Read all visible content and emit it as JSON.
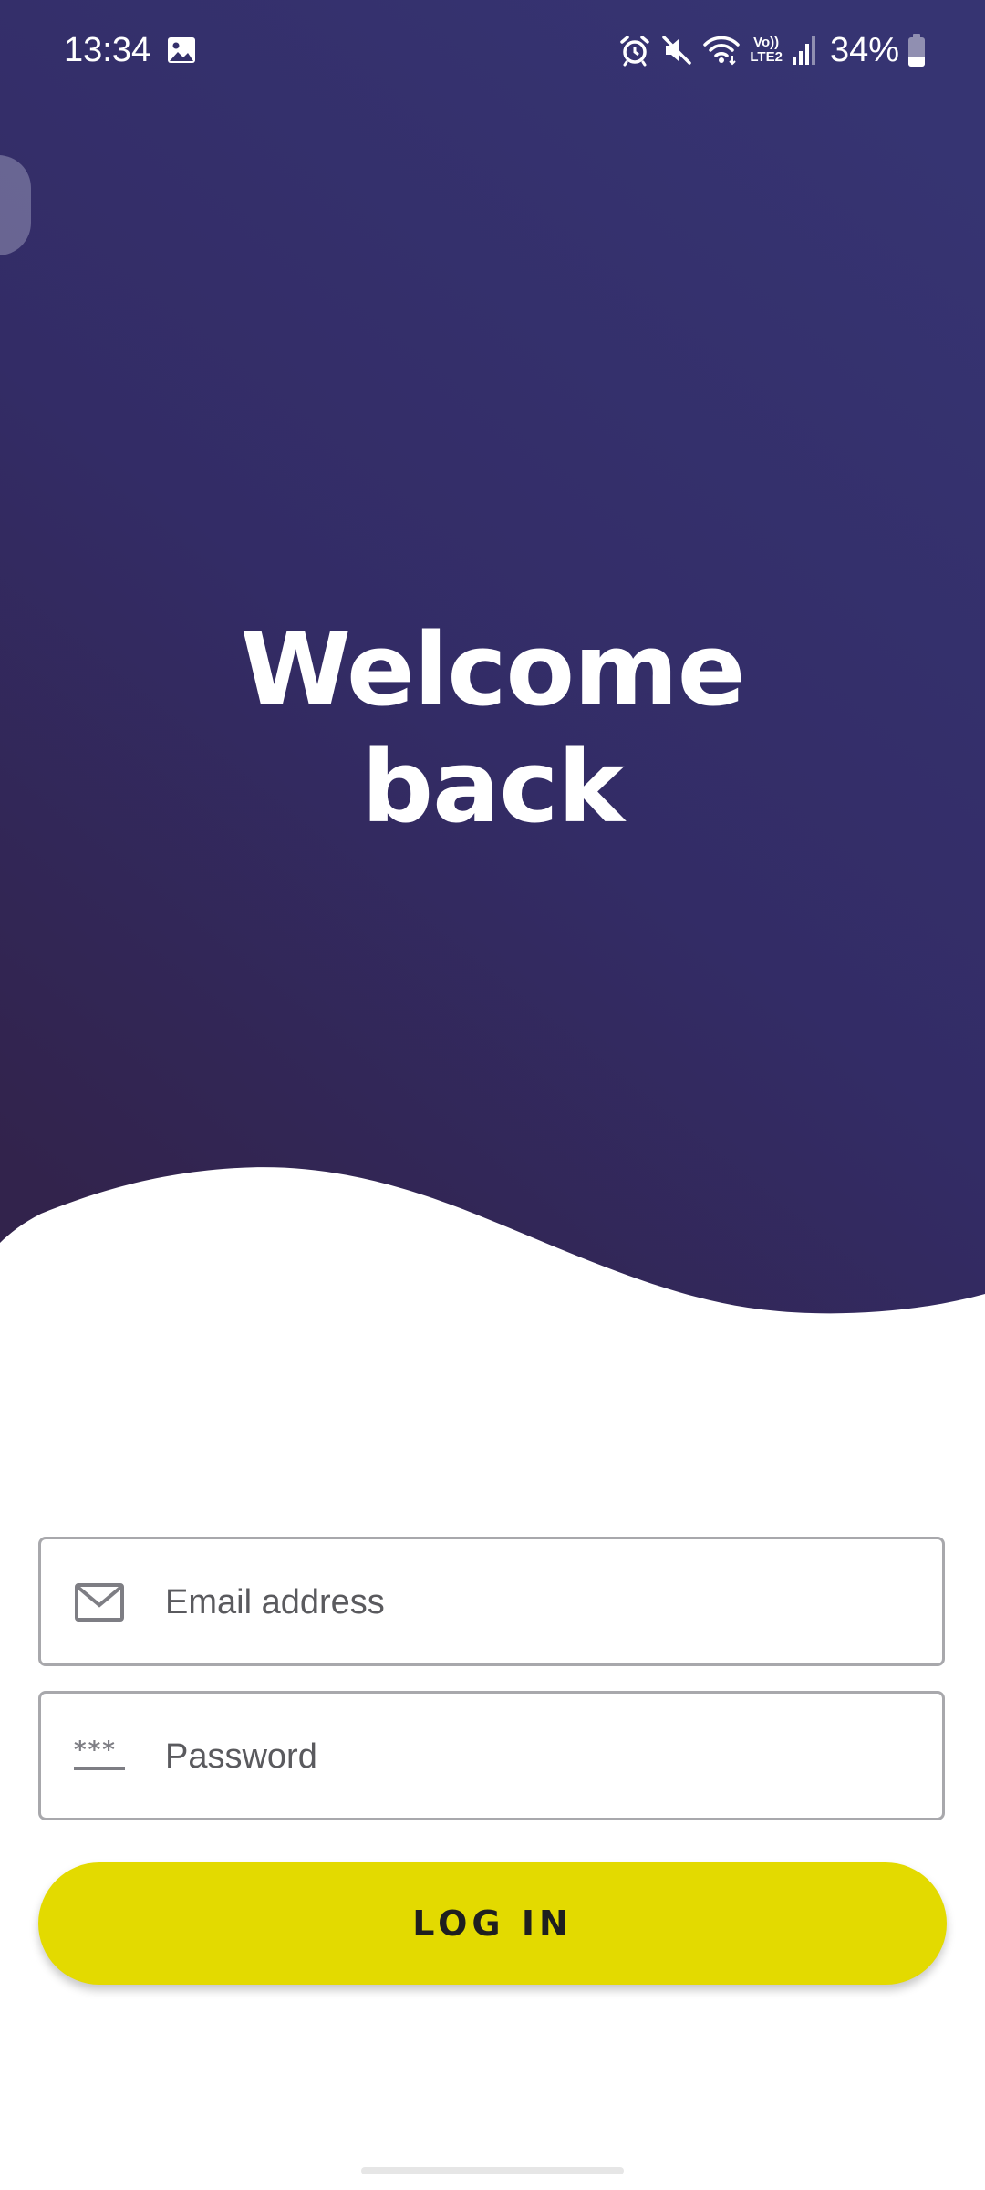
{
  "status_bar": {
    "time": "13:34",
    "volte_top": "Vo))",
    "volte_bottom": "LTE2",
    "battery_percent": "34%",
    "battery_level": 0.34,
    "icons": [
      "gallery-icon",
      "alarm-icon",
      "mute-icon",
      "wifi-icon",
      "volte-icon",
      "signal-icon",
      "battery-icon"
    ]
  },
  "hero": {
    "title_line1": "Welcome",
    "title_line2": "back",
    "gradient_top": "#33306c",
    "gradient_bottom": "#33234f"
  },
  "form": {
    "email_placeholder": "Email address",
    "email_value": "",
    "password_placeholder": "Password",
    "password_value": "",
    "email_icon": "mail-icon",
    "password_icon": "password-dots-icon",
    "login_label": "LOG IN"
  },
  "colors": {
    "accent": "#e3da00",
    "field_border": "#a8a8ac",
    "icon": "#7e7e84"
  }
}
